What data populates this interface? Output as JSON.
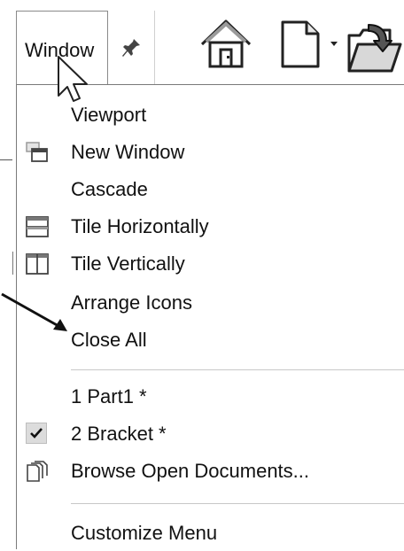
{
  "toolbar": {
    "window_label": "Window",
    "icons": [
      "pin-icon",
      "home-icon",
      "new-document-icon",
      "dropdown-arrow-icon",
      "open-folder-icon"
    ]
  },
  "menu": {
    "items": [
      {
        "label": "Viewport",
        "icon": "none"
      },
      {
        "label": "New Window",
        "icon": "new-window-icon"
      },
      {
        "label": "Cascade",
        "icon": "none"
      },
      {
        "label": "Tile Horizontally",
        "icon": "tile-horizontal-icon"
      },
      {
        "label": "Tile Vertically",
        "icon": "tile-vertical-icon"
      },
      {
        "label": "Arrange Icons",
        "icon": "none"
      },
      {
        "label": "Close All",
        "icon": "none"
      }
    ],
    "documents": [
      {
        "label": "1 Part1 *",
        "checked": false
      },
      {
        "label": "2 Bracket *",
        "checked": true
      },
      {
        "label": "Browse Open Documents...",
        "icon": "browse-documents-icon"
      }
    ],
    "customize_label": "Customize Menu"
  }
}
